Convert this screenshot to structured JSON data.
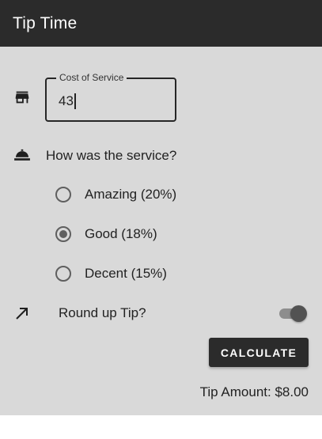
{
  "app_bar": {
    "title": "Tip Time"
  },
  "cost_field": {
    "label": "Cost of Service",
    "value": "43",
    "icon": "store-icon"
  },
  "service": {
    "question": "How was the service?",
    "icon": "room-service-bell-icon",
    "options": [
      {
        "label": "Amazing (20%)",
        "selected": false
      },
      {
        "label": "Good (18%)",
        "selected": true
      },
      {
        "label": "Decent (15%)",
        "selected": false
      }
    ]
  },
  "round_up": {
    "label": "Round up Tip?",
    "icon": "north-east-arrow-icon",
    "enabled": true
  },
  "calculate": {
    "label": "CALCULATE"
  },
  "result": {
    "tip_amount": "Tip Amount: $8.00"
  },
  "colors": {
    "app_bar": "#2b2b2b",
    "background": "#d9d9d9",
    "button": "#2b2b2b",
    "text": "#222222"
  }
}
